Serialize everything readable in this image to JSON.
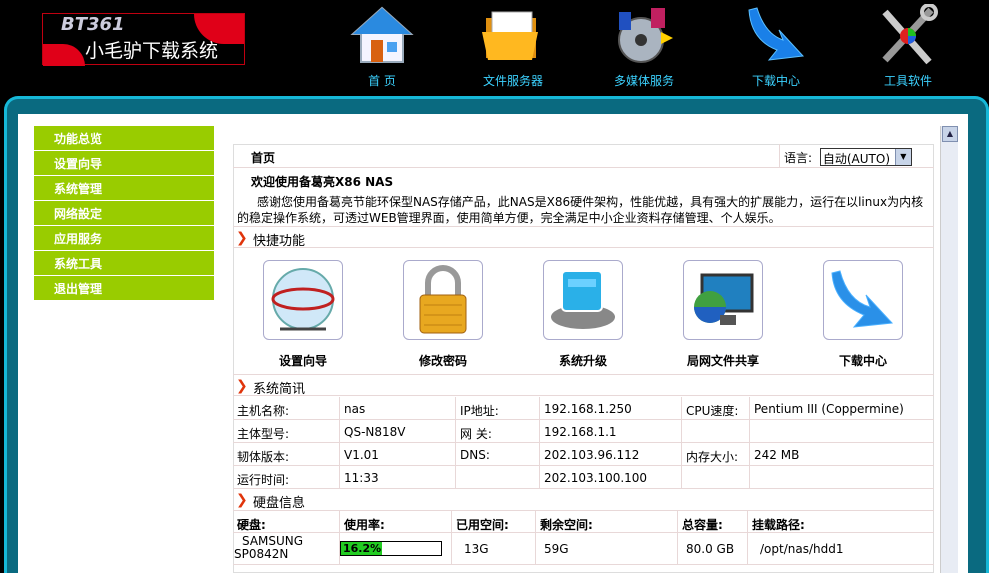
{
  "logo": {
    "brand": "BT361",
    "title": "小毛驴下载系统"
  },
  "nav": [
    {
      "label": "首 页",
      "icon": "home-icon"
    },
    {
      "label": "文件服务器",
      "icon": "folder-icon"
    },
    {
      "label": "多媒体服务",
      "icon": "media-icon"
    },
    {
      "label": "下载中心",
      "icon": "download-arrow-icon"
    },
    {
      "label": "工具软件",
      "icon": "tools-icon"
    }
  ],
  "sidebar": [
    "功能总览",
    "设置向导",
    "系统管理",
    "网络設定",
    "应用服务",
    "系统工具",
    "退出管理"
  ],
  "header": {
    "title": "首页",
    "lang_label": "语言:",
    "lang_value": "自动(AUTO)"
  },
  "welcome": {
    "title": "欢迎使用备葛亮X86 NAS",
    "text1": "感谢您使用备葛亮节能环保型NAS存储产品，此NAS是X86硬件架构，性能优越，具有强大的扩展能力，运行在以linux为内核",
    "text2": "的稳定操作系统，可透过WEB管理界面，使用简单方便，完全满足中小企业资料存储管理、个人娱乐。"
  },
  "quick": {
    "title": "快捷功能",
    "items": [
      "设置向导",
      "修改密码",
      "系统升级",
      "局网文件共享",
      "下载中心"
    ]
  },
  "sysinfo": {
    "title": "系统简讯",
    "rows": [
      [
        "主机名称:",
        "nas",
        "IP地址:",
        "192.168.1.250",
        "CPU速度:",
        "Pentium III (Coppermine)"
      ],
      [
        "主体型号:",
        "QS-N818V",
        "网 关:",
        "192.168.1.1",
        "",
        ""
      ],
      [
        "韧体版本:",
        "V1.01",
        "DNS:",
        "202.103.96.112",
        "内存大小:",
        "242 MB"
      ],
      [
        "运行时间:",
        "11:33",
        "",
        "202.103.100.100",
        "",
        ""
      ]
    ]
  },
  "disk": {
    "title": "硬盘信息",
    "headers": [
      "硬盘:",
      "使用率:",
      "已用空间:",
      "剩余空间:",
      "总容量:",
      "挂载路径:"
    ],
    "rows": [
      {
        "name1": "SAMSUNG",
        "name2": "SP0842N",
        "usage": "16.2%",
        "usage_frac": 0.162,
        "used": "13G",
        "free": "59G",
        "total": "80.0 GB",
        "path": "/opt/nas/hdd1"
      }
    ]
  }
}
